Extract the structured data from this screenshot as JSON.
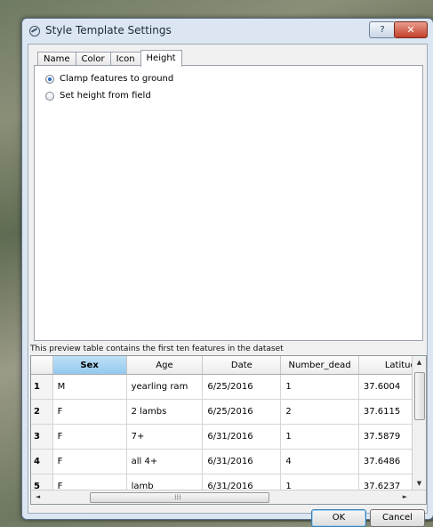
{
  "window": {
    "title": "Style Template Settings",
    "help_label": "?",
    "close_label": "✕"
  },
  "tabs": [
    {
      "label": "Name"
    },
    {
      "label": "Color"
    },
    {
      "label": "Icon"
    },
    {
      "label": "Height",
      "active": true
    }
  ],
  "height_options": [
    {
      "label": "Clamp features to ground",
      "selected": true
    },
    {
      "label": "Set height from field",
      "selected": false
    }
  ],
  "preview": {
    "caption": "This preview table contains the first ten features in the dataset",
    "columns": [
      "Sex",
      "Age",
      "Date",
      "Number_dead",
      "Latitude"
    ],
    "rows": [
      {
        "num": "1",
        "cells": [
          "M",
          "yearling ram",
          "6/25/2016",
          "1",
          "37.6004"
        ]
      },
      {
        "num": "2",
        "cells": [
          "F",
          "2 lambs",
          "6/25/2016",
          "2",
          "37.6115"
        ]
      },
      {
        "num": "3",
        "cells": [
          "F",
          "7+",
          "6/31/2016",
          "1",
          "37.5879"
        ]
      },
      {
        "num": "4",
        "cells": [
          "F",
          "all 4+",
          "6/31/2016",
          "4",
          "37.6486"
        ]
      },
      {
        "num": "5",
        "cells": [
          "F",
          "lamb",
          "6/31/2016",
          "1",
          "37.6237"
        ]
      }
    ]
  },
  "buttons": {
    "ok": "OK",
    "cancel": "Cancel"
  },
  "icons": {
    "title": "dialog-settings-icon",
    "scroll_up": "▲",
    "scroll_down": "▼",
    "scroll_left": "◄",
    "scroll_right": "►",
    "grip": "⁞⁞⁞"
  },
  "colors": {
    "sorted_header": "#93c9ee",
    "close_button": "#c2402b"
  }
}
